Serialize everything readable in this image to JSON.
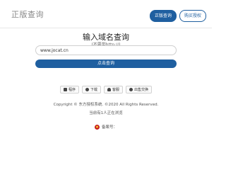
{
  "header": {
    "logo_text": "正版查询",
    "nav": [
      {
        "label": "正版查询"
      },
      {
        "label": "购买授权"
      }
    ]
  },
  "main": {
    "title": "输入域名查询",
    "subtitle": "(不要带http://)",
    "input": {
      "value": "www.jocat.cn",
      "placeholder": ""
    },
    "query_button": "点击查询"
  },
  "tools": [
    {
      "label": "程序",
      "icon": "grid-icon"
    },
    {
      "label": "下载",
      "icon": "download-icon"
    },
    {
      "label": "客服",
      "icon": "person-icon"
    },
    {
      "label": "出售交换",
      "icon": "exchange-icon"
    }
  ],
  "footer": {
    "copyright": "Copyright © 东方授权系统. ©2020 All Rights Reserved.",
    "online": "当前有1人正在浏览",
    "beian": "备案号："
  },
  "colors": {
    "accent": "#1f5fa0"
  }
}
